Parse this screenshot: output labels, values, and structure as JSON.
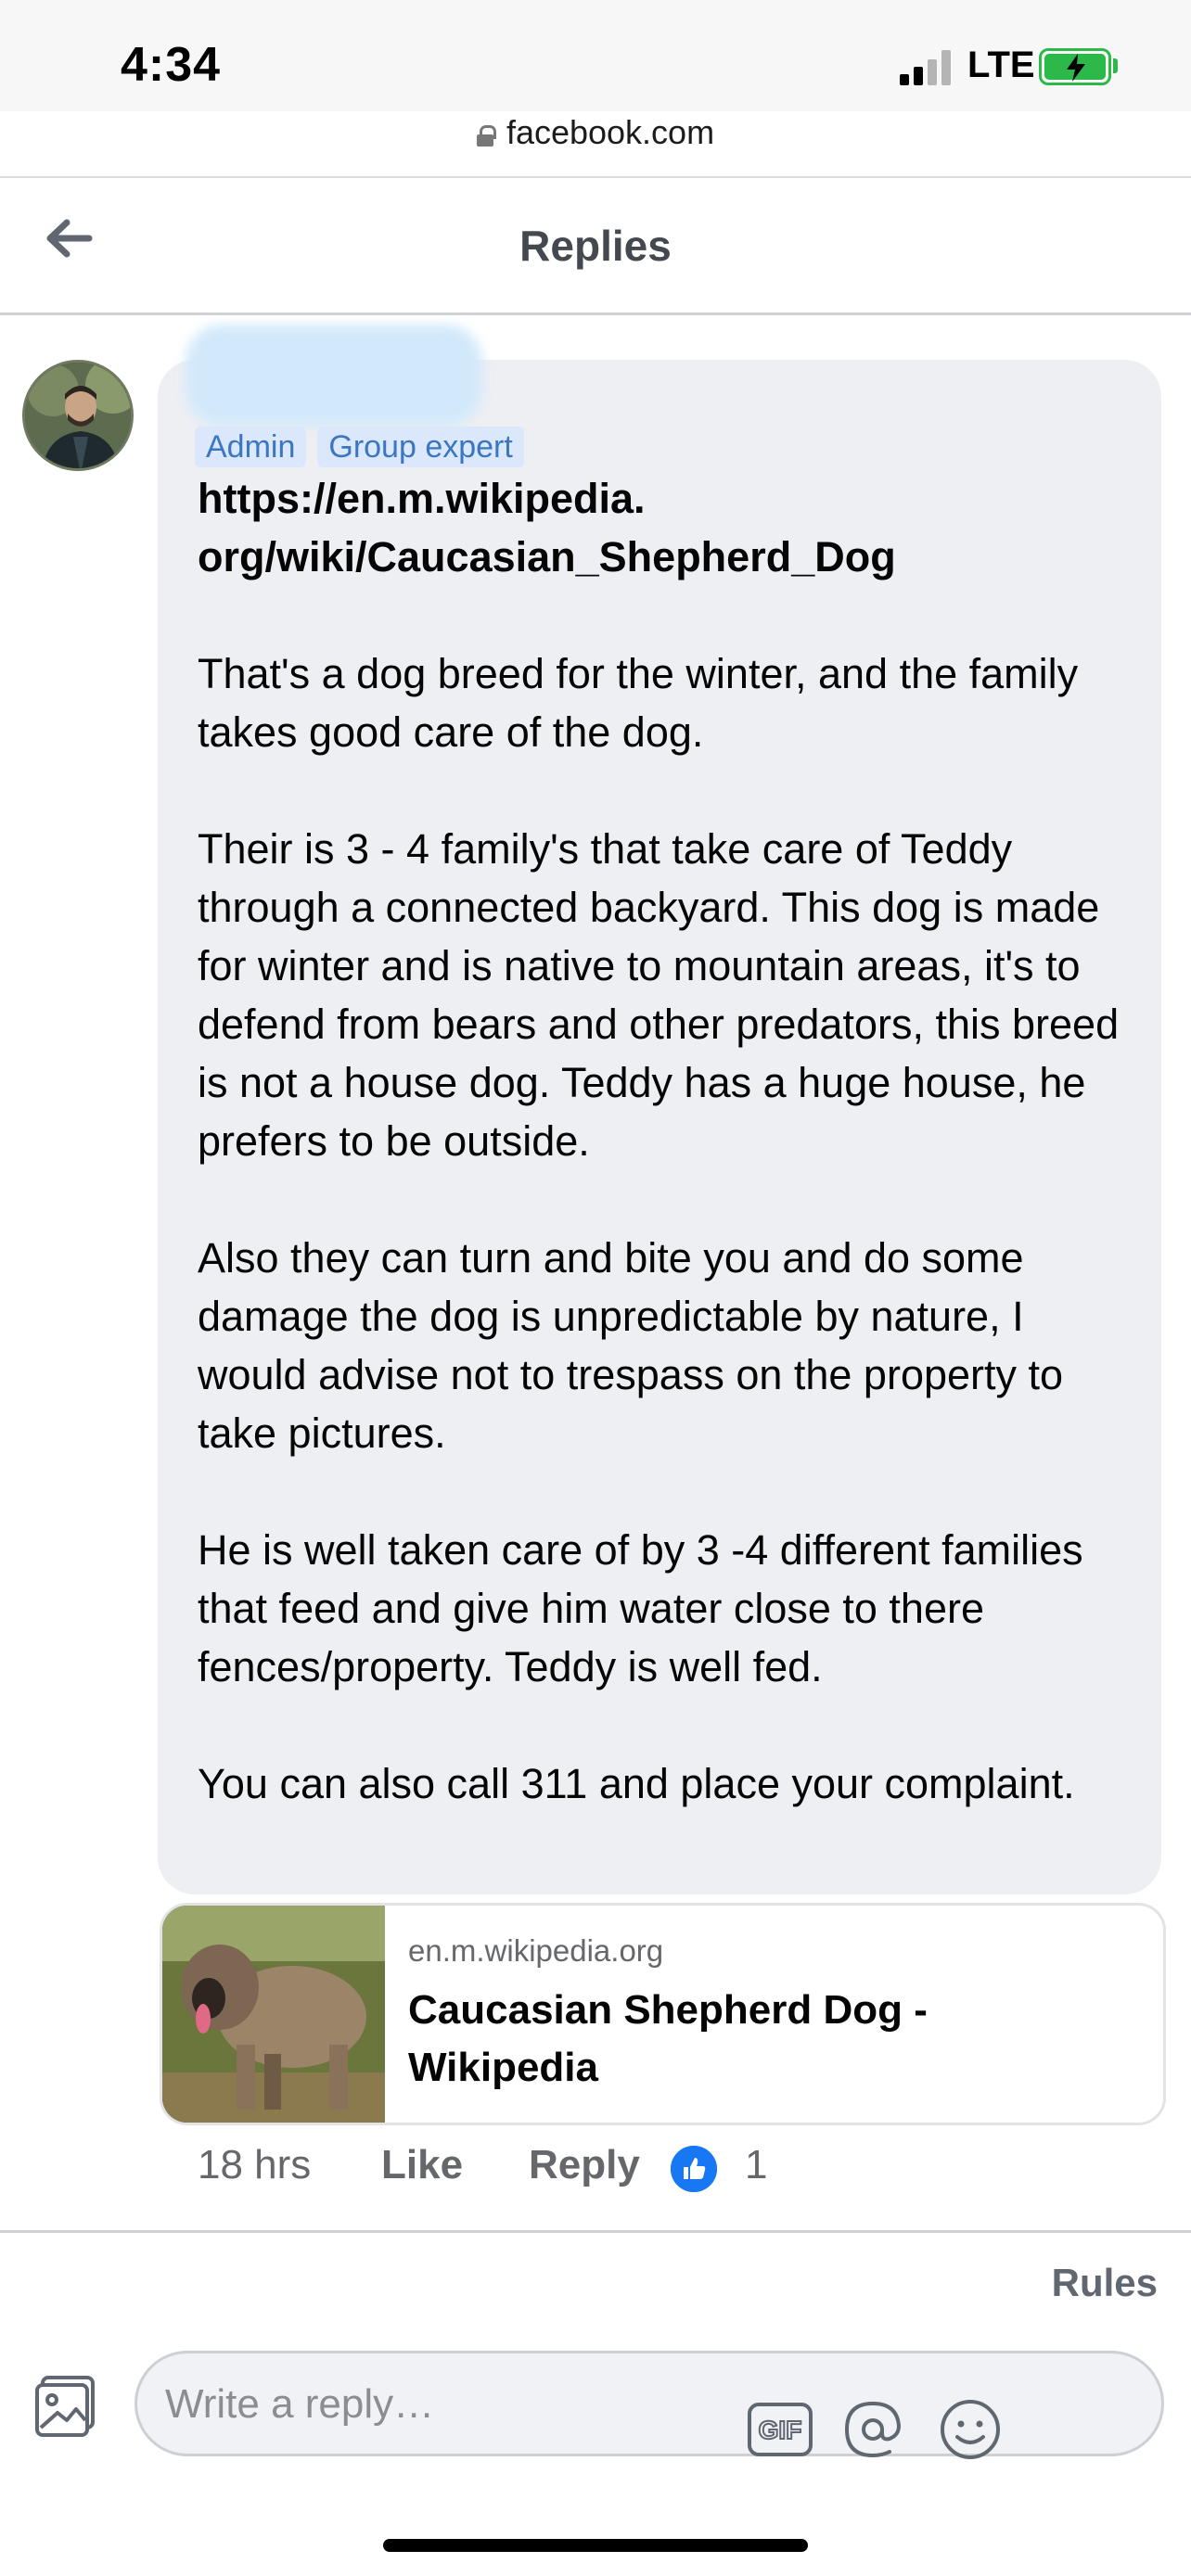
{
  "status_bar": {
    "time": "4:34",
    "network": "LTE",
    "battery_color": "#2db84a",
    "url": "facebook.com"
  },
  "header": {
    "title": "Replies",
    "back_icon": "arrow-left-icon"
  },
  "comment": {
    "badges": [
      "Admin",
      "Group expert"
    ],
    "link_text": "https://en.m.wikipedia. org/wiki/Caucasian_Shepherd_Dog",
    "paragraphs": [
      "That's a dog breed for the winter, and the family takes good care of the dog.",
      "Their is 3 - 4 family's that take care of Teddy through a connected backyard. This dog is made for winter and is native to mountain areas, it's to defend from bears and other predators, this breed is not a house dog. Teddy has a huge house, he prefers to be outside.",
      "Also they can turn and bite you and do some damage the dog is unpredictable by nature, I would advise not to trespass on the property to take pictures.",
      "He is well taken care of by 3 -4 different families that feed and give him water close to there fences/property. Teddy is well fed.",
      "You can also call 311 and place your complaint."
    ],
    "link_preview": {
      "domain": "en.m.wikipedia.org",
      "title": "Caucasian Shepherd Dog - Wikipedia"
    },
    "actions": {
      "time": "18 hrs",
      "like": "Like",
      "reply": "Reply",
      "reaction_count": "1",
      "reaction_color": "#1877f2"
    }
  },
  "footer": {
    "rules": "Rules",
    "reply_placeholder": "Write a reply…"
  }
}
